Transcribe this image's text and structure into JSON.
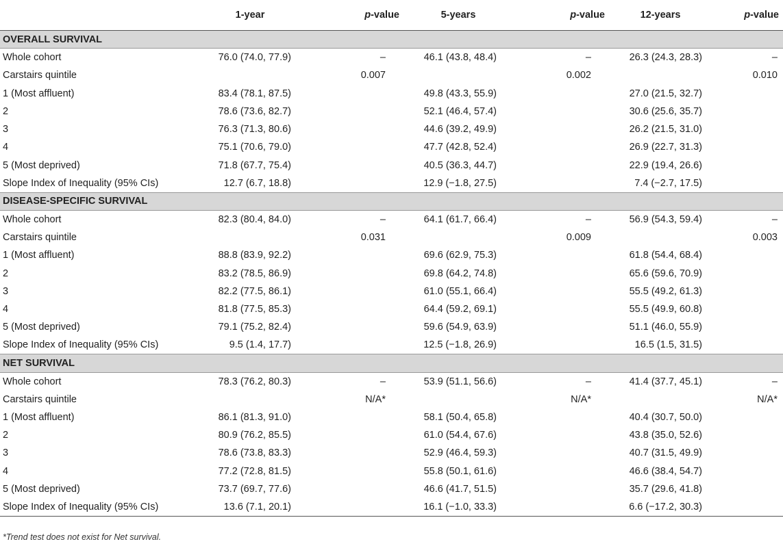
{
  "header": {
    "col0": "",
    "col1": "1-year",
    "col2_p": "p",
    "col2_rest": "-value",
    "col3": "5-years",
    "col4_p": "p",
    "col4_rest": "-value",
    "col5": "12-years",
    "col6_p": "p",
    "col6_rest": "-value"
  },
  "sections": [
    {
      "title": "OVERALL SURVIVAL",
      "rows": [
        {
          "label": "Whole cohort",
          "y1": "76.0 (74.0, 77.9)",
          "p1": "–",
          "y5": "46.1 (43.8, 48.4)",
          "p5": "–",
          "y12": "26.3 (24.3, 28.3)",
          "p12": "–"
        },
        {
          "label": "Carstairs quintile",
          "y1": "",
          "p1": "0.007",
          "y5": "",
          "p5": "0.002",
          "y12": "",
          "p12": "0.010"
        },
        {
          "label": "1 (Most affluent)",
          "y1": "83.4 (78.1, 87.5)",
          "p1": "",
          "y5": "49.8 (43.3, 55.9)",
          "p5": "",
          "y12": "27.0 (21.5, 32.7)",
          "p12": ""
        },
        {
          "label": "2",
          "y1": "78.6 (73.6, 82.7)",
          "p1": "",
          "y5": "52.1 (46.4, 57.4)",
          "p5": "",
          "y12": "30.6 (25.6, 35.7)",
          "p12": ""
        },
        {
          "label": "3",
          "y1": "76.3 (71.3, 80.6)",
          "p1": "",
          "y5": "44.6 (39.2, 49.9)",
          "p5": "",
          "y12": "26.2 (21.5, 31.0)",
          "p12": ""
        },
        {
          "label": "4",
          "y1": "75.1 (70.6, 79.0)",
          "p1": "",
          "y5": "47.7 (42.8, 52.4)",
          "p5": "",
          "y12": "26.9 (22.7, 31.3)",
          "p12": ""
        },
        {
          "label": "5 (Most deprived)",
          "y1": "71.8 (67.7, 75.4)",
          "p1": "",
          "y5": "40.5 (36.3, 44.7)",
          "p5": "",
          "y12": "22.9 (19.4, 26.6)",
          "p12": ""
        },
        {
          "label": "Slope Index of Inequality (95% CIs)",
          "y1": "12.7 (6.7, 18.8)",
          "p1": "",
          "y5": "12.9 (−1.8, 27.5)",
          "p5": "",
          "y12": "7.4 (−2.7, 17.5)",
          "p12": ""
        }
      ]
    },
    {
      "title": "DISEASE-SPECIFIC SURVIVAL",
      "rows": [
        {
          "label": "Whole cohort",
          "y1": "82.3 (80.4, 84.0)",
          "p1": "–",
          "y5": "64.1 (61.7, 66.4)",
          "p5": "–",
          "y12": "56.9 (54.3, 59.4)",
          "p12": "–"
        },
        {
          "label": "Carstairs quintile",
          "y1": "",
          "p1": "0.031",
          "y5": "",
          "p5": "0.009",
          "y12": "",
          "p12": "0.003"
        },
        {
          "label": "1 (Most affluent)",
          "y1": "88.8 (83.9, 92.2)",
          "p1": "",
          "y5": "69.6 (62.9, 75.3)",
          "p5": "",
          "y12": "61.8 (54.4, 68.4)",
          "p12": ""
        },
        {
          "label": "2",
          "y1": "83.2 (78.5, 86.9)",
          "p1": "",
          "y5": "69.8 (64.2, 74.8)",
          "p5": "",
          "y12": "65.6 (59.6, 70.9)",
          "p12": ""
        },
        {
          "label": "3",
          "y1": "82.2 (77.5, 86.1)",
          "p1": "",
          "y5": "61.0 (55.1, 66.4)",
          "p5": "",
          "y12": "55.5 (49.2, 61.3)",
          "p12": ""
        },
        {
          "label": "4",
          "y1": "81.8 (77.5, 85.3)",
          "p1": "",
          "y5": "64.4 (59.2, 69.1)",
          "p5": "",
          "y12": "55.5 (49.9, 60.8)",
          "p12": ""
        },
        {
          "label": "5 (Most deprived)",
          "y1": "79.1 (75.2, 82.4)",
          "p1": "",
          "y5": "59.6 (54.9, 63.9)",
          "p5": "",
          "y12": "51.1 (46.0, 55.9)",
          "p12": ""
        },
        {
          "label": "Slope Index of Inequality (95% CIs)",
          "y1": "9.5 (1.4, 17.7)",
          "p1": "",
          "y5": "12.5 (−1.8, 26.9)",
          "p5": "",
          "y12": "16.5 (1.5, 31.5)",
          "p12": ""
        }
      ]
    },
    {
      "title": "NET SURVIVAL",
      "rows": [
        {
          "label": "Whole cohort",
          "y1": "78.3 (76.2, 80.3)",
          "p1": "–",
          "y5": "53.9 (51.1, 56.6)",
          "p5": "–",
          "y12": "41.4 (37.7, 45.1)",
          "p12": "–"
        },
        {
          "label": "Carstairs quintile",
          "y1": "",
          "p1": "N/A*",
          "y5": "",
          "p5": "N/A*",
          "y12": "",
          "p12": "N/A*"
        },
        {
          "label": "1 (Most affluent)",
          "y1": "86.1 (81.3, 91.0)",
          "p1": "",
          "y5": "58.1 (50.4, 65.8)",
          "p5": "",
          "y12": "40.4 (30.7, 50.0)",
          "p12": ""
        },
        {
          "label": "2",
          "y1": "80.9 (76.2, 85.5)",
          "p1": "",
          "y5": "61.0 (54.4, 67.6)",
          "p5": "",
          "y12": "43.8 (35.0, 52.6)",
          "p12": ""
        },
        {
          "label": "3",
          "y1": "78.6 (73.8, 83.3)",
          "p1": "",
          "y5": "52.9 (46.4, 59.3)",
          "p5": "",
          "y12": "40.7 (31.5, 49.9)",
          "p12": ""
        },
        {
          "label": "4",
          "y1": "77.2 (72.8, 81.5)",
          "p1": "",
          "y5": "55.8 (50.1, 61.6)",
          "p5": "",
          "y12": "46.6 (38.4, 54.7)",
          "p12": ""
        },
        {
          "label": "5 (Most deprived)",
          "y1": "73.7 (69.7, 77.6)",
          "p1": "",
          "y5": "46.6 (41.7, 51.5)",
          "p5": "",
          "y12": "35.7 (29.6, 41.8)",
          "p12": ""
        },
        {
          "label": "Slope Index of Inequality (95% CIs)",
          "y1": "13.6 (7.1, 20.1)",
          "p1": "",
          "y5": "16.1 (−1.0, 33.3)",
          "p5": "",
          "y12": "6.6 (−17.2, 30.3)",
          "p12": ""
        }
      ]
    }
  ],
  "footnote": "*Trend test does not exist for Net survival."
}
